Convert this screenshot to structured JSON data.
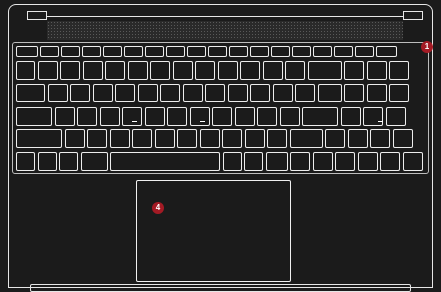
{
  "callouts": {
    "callout_1": "1",
    "callout_4": "4"
  },
  "colors": {
    "background": "#1b1b1b",
    "outline": "#e6e6e6",
    "callout_fill": "#a31a24",
    "callout_text": "#ffffff",
    "speaker_grille": "#2a2a2a"
  }
}
